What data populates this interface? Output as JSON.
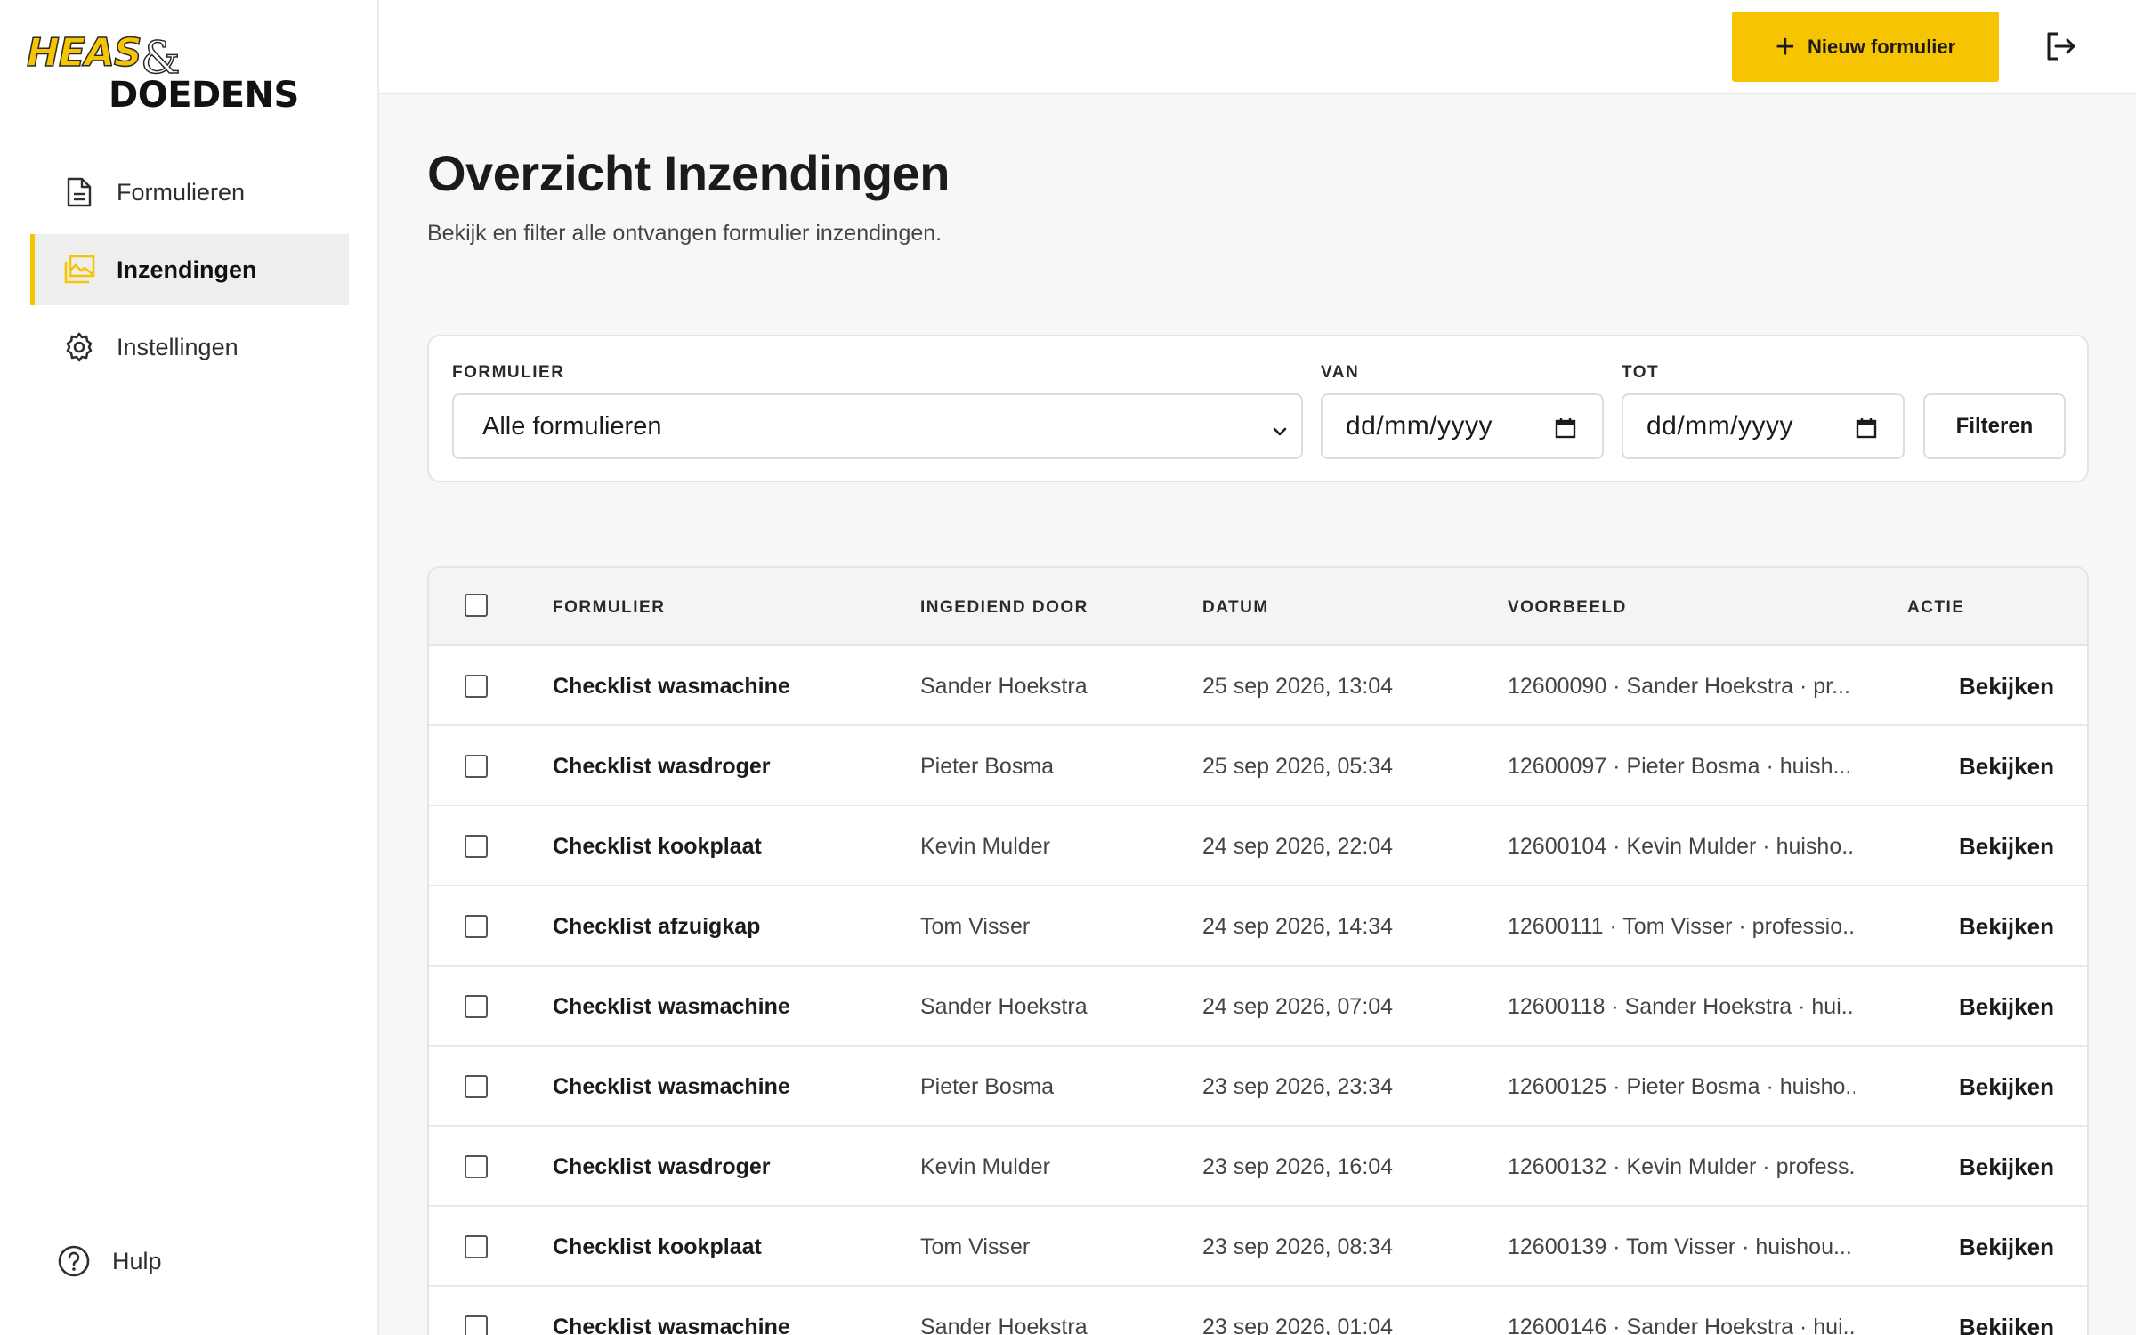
{
  "brand": {
    "line1": "HEAS",
    "amp": "&",
    "line2": "DOEDENS",
    "accent": "#f6c400"
  },
  "sidebar": {
    "items": [
      {
        "label": "Formulieren",
        "icon": "document-icon",
        "active": false
      },
      {
        "label": "Inzendingen",
        "icon": "inbox-images-icon",
        "active": true
      },
      {
        "label": "Instellingen",
        "icon": "gear-icon",
        "active": false
      }
    ],
    "help_label": "Hulp"
  },
  "topbar": {
    "new_form_label": "Nieuw formulier",
    "logout_icon": "logout-icon"
  },
  "header": {
    "title": "Overzicht Inzendingen",
    "subtitle": "Bekijk en filter alle ontvangen formulier inzendingen."
  },
  "filters": {
    "form_label": "FORMULIER",
    "form_value": "Alle formulieren",
    "from_label": "VAN",
    "from_placeholder": "dd/mm/yyyy",
    "to_label": "TOT",
    "to_placeholder": "dd/mm/yyyy",
    "button_label": "Filteren"
  },
  "table": {
    "columns": [
      "FORMULIER",
      "INGEDIEND DOOR",
      "DATUM",
      "VOORBEELD",
      "ACTIE"
    ],
    "rows": [
      {
        "form": "Checklist wasmachine",
        "by": "Sander Hoekstra",
        "date": "25 sep 2026, 13:04",
        "preview": "12600090 · Sander Hoekstra · pr...",
        "action": "Bekijken"
      },
      {
        "form": "Checklist wasdroger",
        "by": "Pieter Bosma",
        "date": "25 sep 2026, 05:34",
        "preview": "12600097 · Pieter Bosma · huish...",
        "action": "Bekijken"
      },
      {
        "form": "Checklist kookplaat",
        "by": "Kevin Mulder",
        "date": "24 sep 2026, 22:04",
        "preview": "12600104 · Kevin Mulder · huisho...",
        "action": "Bekijken"
      },
      {
        "form": "Checklist afzuigkap",
        "by": "Tom Visser",
        "date": "24 sep 2026, 14:34",
        "preview": "12600111 · Tom Visser · professio...",
        "action": "Bekijken"
      },
      {
        "form": "Checklist wasmachine",
        "by": "Sander Hoekstra",
        "date": "24 sep 2026, 07:04",
        "preview": "12600118 · Sander Hoekstra · hui...",
        "action": "Bekijken"
      },
      {
        "form": "Checklist wasmachine",
        "by": "Pieter Bosma",
        "date": "23 sep 2026, 23:34",
        "preview": "12600125 · Pieter Bosma · huisho...",
        "action": "Bekijken"
      },
      {
        "form": "Checklist wasdroger",
        "by": "Kevin Mulder",
        "date": "23 sep 2026, 16:04",
        "preview": "12600132 · Kevin Mulder · profess...",
        "action": "Bekijken"
      },
      {
        "form": "Checklist kookplaat",
        "by": "Tom Visser",
        "date": "23 sep 2026, 08:34",
        "preview": "12600139 · Tom Visser · huishou...",
        "action": "Bekijken"
      },
      {
        "form": "Checklist wasmachine",
        "by": "Sander Hoekstra",
        "date": "23 sep 2026, 01:04",
        "preview": "12600146 · Sander Hoekstra · hui...",
        "action": "Bekijken"
      }
    ]
  }
}
